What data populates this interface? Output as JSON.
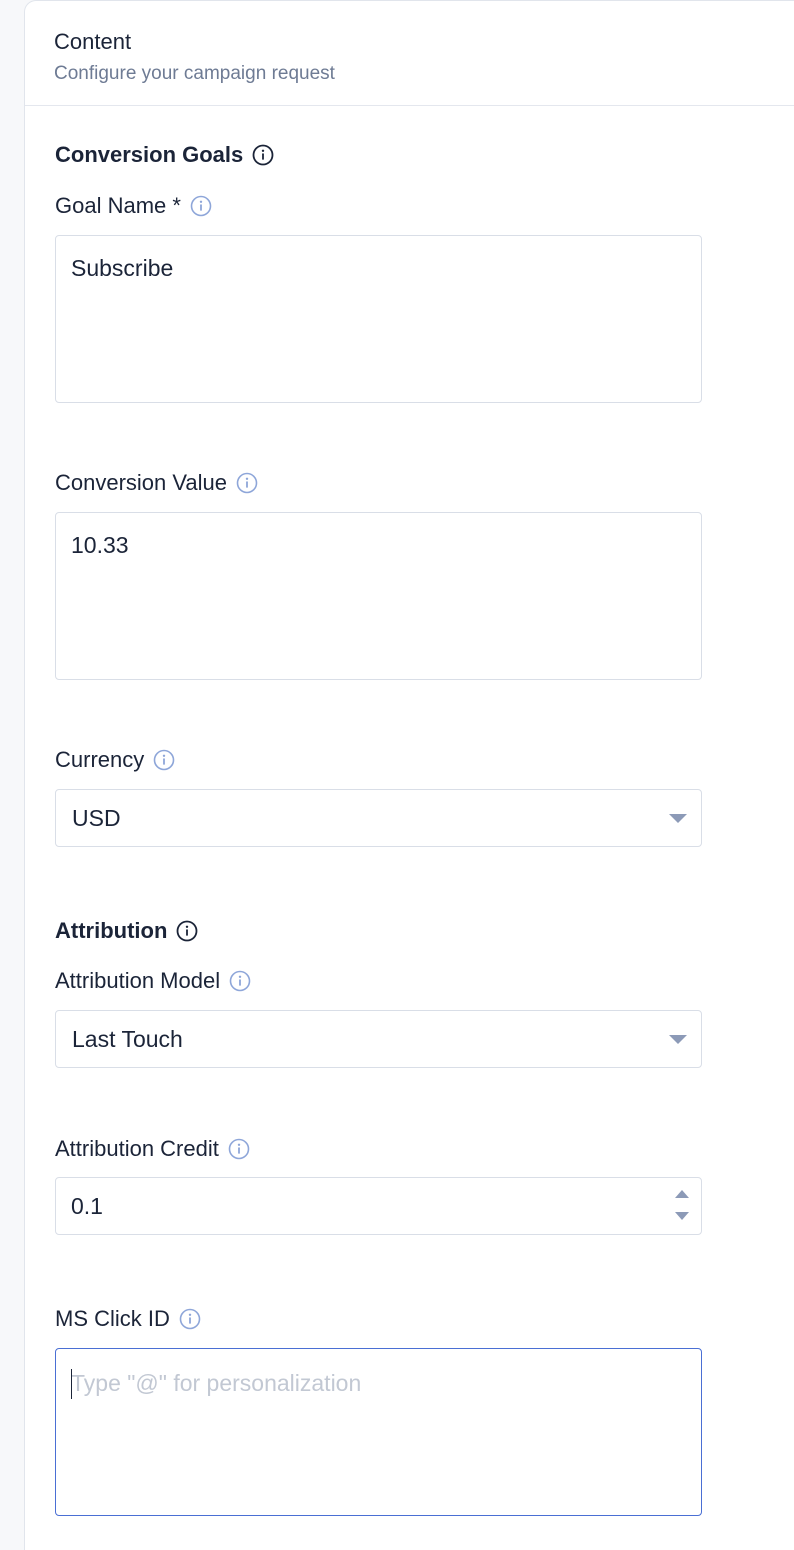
{
  "header": {
    "title": "Content",
    "subtitle": "Configure your campaign request"
  },
  "conversion_goals": {
    "title": "Conversion Goals",
    "info_icon": "info-icon",
    "goal_name": {
      "label": "Goal Name *",
      "value": "Subscribe"
    },
    "conversion_value": {
      "label": "Conversion Value",
      "value": "10.33"
    },
    "currency": {
      "label": "Currency",
      "selected": "USD"
    }
  },
  "attribution": {
    "title": "Attribution",
    "model": {
      "label": "Attribution Model",
      "selected": "Last Touch"
    },
    "credit": {
      "label": "Attribution Credit",
      "value": "0.1"
    }
  },
  "ms_click_id": {
    "label": "MS Click ID",
    "value": "",
    "placeholder": "Type \"@\" for personalization"
  },
  "colors": {
    "text_primary": "#1b2438",
    "text_secondary": "#6e7b94",
    "info_icon_section": "#1b2438",
    "info_icon_field": "#8ea6d9",
    "focus_border": "#4a6fd4",
    "border": "#d9dee7",
    "placeholder": "#c2c8d3"
  }
}
